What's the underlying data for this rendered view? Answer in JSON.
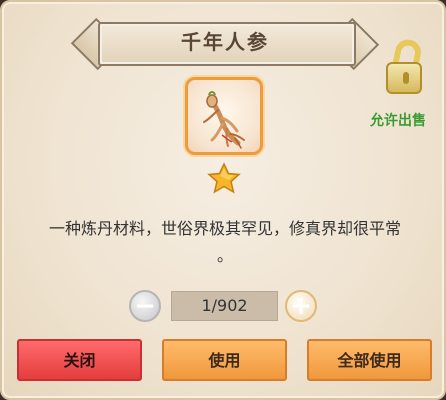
{
  "item": {
    "name": "千年人参",
    "description_line1": "一种炼丹材料，世俗界极其罕见，修真界却很平常",
    "description_line2": "。",
    "icon": "ginseng-root-icon",
    "rarity_stars": 1
  },
  "sale": {
    "label": "允许出售",
    "icon": "unlocked-padlock-icon"
  },
  "quantity": {
    "value": "1/902",
    "minus_icon": "minus-icon",
    "plus_icon": "plus-icon"
  },
  "buttons": {
    "close_label": "关闭",
    "use_label": "使用",
    "use_all_label": "全部使用"
  },
  "colors": {
    "close_button": "#e84a4a",
    "action_button": "#f5a24b",
    "sale_text": "#3a9b32",
    "item_border": "#ef9b3a"
  }
}
